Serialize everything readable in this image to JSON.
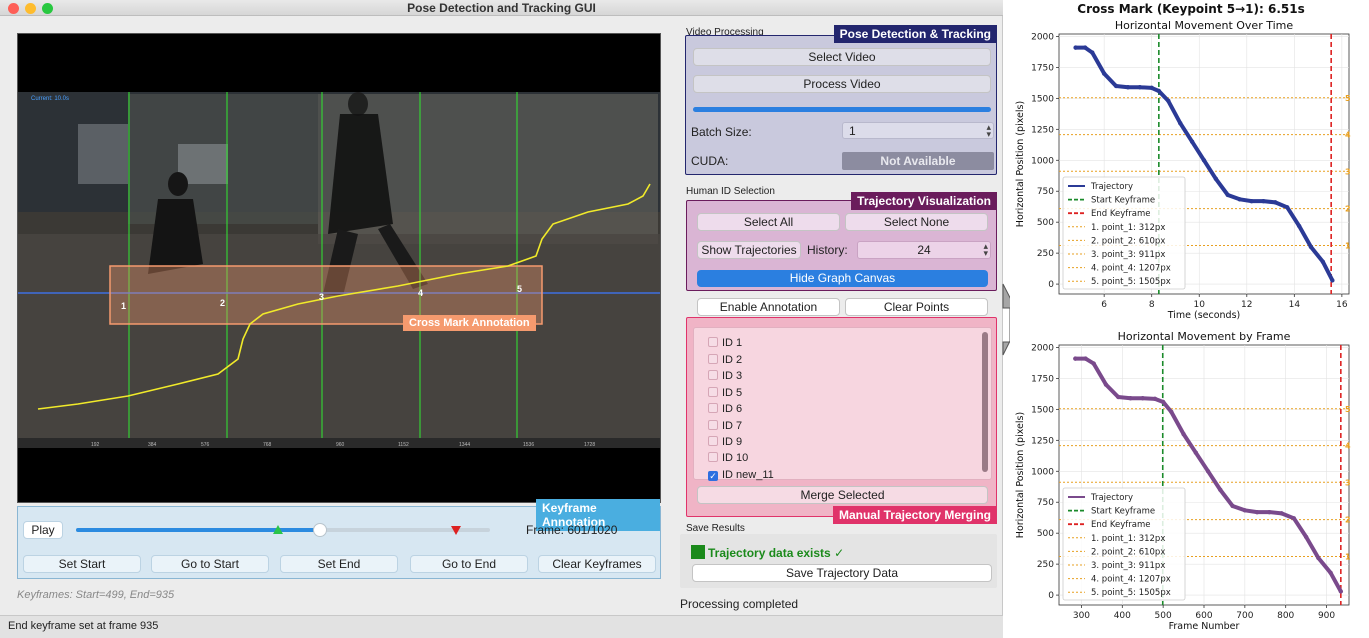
{
  "window": {
    "title": "Pose Detection and Tracking GUI",
    "traffic_lights": [
      "#fe5f57",
      "#febc2e",
      "#28c840"
    ]
  },
  "video": {
    "current_label": "Current: 10.0s",
    "cross_mark_label": "Cross Mark Annotation",
    "point_labels": [
      "1",
      "2",
      "3",
      "4",
      "5"
    ],
    "axis_ticks": [
      "192",
      "384",
      "576",
      "768",
      "960",
      "1152",
      "1344",
      "1536",
      "1728"
    ]
  },
  "keyframe": {
    "panel_label": "Keyframe Annotation",
    "play_label": "Play",
    "frame_text": "Frame: 601/1020",
    "slider_position": 0.589,
    "start_marker": 0.489,
    "end_marker": 0.917,
    "buttons": [
      "Set Start",
      "Go to Start",
      "Set End",
      "Go to End",
      "Clear Keyframes"
    ],
    "status_text": "Keyframes: Start=499, End=935"
  },
  "status_bar": "End keyframe set at frame 935",
  "video_processing": {
    "section_label": "Video Processing",
    "panel_label": "Pose Detection & Tracking",
    "select_video": "Select Video",
    "process_video": "Process Video",
    "progress": 1.0,
    "batch_size_label": "Batch Size:",
    "batch_size_value": "1",
    "cuda_label": "CUDA:",
    "cuda_value": "Not Available"
  },
  "human_id": {
    "section_label": "Human ID Selection",
    "panel_label": "Trajectory Visualization",
    "select_all": "Select All",
    "select_none": "Select None",
    "show_trajectories": "Show Trajectories",
    "history_label": "History:",
    "history_value": "24",
    "hide_graph": "Hide Graph Canvas",
    "enable_annotation": "Enable Annotation",
    "clear_points": "Clear Points",
    "ids": [
      {
        "label": "ID 1",
        "checked": false
      },
      {
        "label": "ID 2",
        "checked": false
      },
      {
        "label": "ID 3",
        "checked": false
      },
      {
        "label": "ID 5",
        "checked": false
      },
      {
        "label": "ID 6",
        "checked": false
      },
      {
        "label": "ID 7",
        "checked": false
      },
      {
        "label": "ID 9",
        "checked": false
      },
      {
        "label": "ID 10",
        "checked": false
      },
      {
        "label": "ID new_11",
        "checked": true
      }
    ],
    "merge_selected": "Merge Selected",
    "merge_panel_label": "Manual Trajectory Merging"
  },
  "save": {
    "section_label": "Save Results",
    "exists_text": "Trajectory data exists ✓",
    "save_button": "Save Trajectory Data",
    "status": "Processing completed"
  },
  "colors": {
    "pose_panel": "#23266e",
    "traj_panel": "#6a1c5c",
    "merge_panel": "#e0336a",
    "keyframe_panel": "#4aaee0",
    "cross_mark": "#f59a6e",
    "trajectory_time": "#2b3a96",
    "trajectory_frame": "#7a4a8c",
    "start_line": "#1a8a2a",
    "end_line": "#dd2222",
    "guide_line": "#e8a020"
  },
  "chart_data": [
    {
      "type": "line",
      "title": "Horizontal Movement Over Time",
      "suptitle": "Cross Mark (Keypoint 5→1): 6.51s",
      "xlabel": "Time (seconds)",
      "ylabel": "Horizontal Position (pixels)",
      "xlim": [
        4.1,
        16.3
      ],
      "ylim": [
        -80,
        2020
      ],
      "xticks": [
        "6",
        "8",
        "10",
        "12",
        "14",
        "16"
      ],
      "yticks": [
        "0",
        "250",
        "500",
        "750",
        "1000",
        "1250",
        "1500",
        "1750",
        "2000"
      ],
      "series": [
        {
          "name": "Trajectory",
          "x": [
            4.8,
            5.2,
            5.5,
            6.0,
            6.5,
            7.0,
            7.5,
            8.0,
            8.3,
            8.7,
            9.2,
            9.7,
            10.2,
            10.7,
            11.2,
            11.7,
            12.2,
            12.7,
            13.2,
            13.7,
            14.2,
            14.7,
            15.2,
            15.6
          ],
          "y": [
            1910,
            1910,
            1870,
            1700,
            1600,
            1590,
            1590,
            1585,
            1560,
            1480,
            1300,
            1150,
            1000,
            850,
            720,
            685,
            670,
            670,
            660,
            620,
            470,
            300,
            180,
            30
          ]
        }
      ],
      "vlines": [
        {
          "name": "Start Keyframe",
          "x": 8.3
        },
        {
          "name": "End Keyframe",
          "x": 15.55
        }
      ],
      "hlines": [
        {
          "name": "1. point_1: 312px",
          "y": 312,
          "tag": "1"
        },
        {
          "name": "2. point_2: 610px",
          "y": 610,
          "tag": "2"
        },
        {
          "name": "3. point_3: 911px",
          "y": 911,
          "tag": "3"
        },
        {
          "name": "4. point_4: 1207px",
          "y": 1207,
          "tag": "4"
        },
        {
          "name": "5. point_5: 1505px",
          "y": 1505,
          "tag": "5"
        }
      ],
      "legend_position": "lower-left",
      "grid": true
    },
    {
      "type": "line",
      "title": "Horizontal Movement by Frame",
      "xlabel": "Frame Number",
      "ylabel": "Horizontal Position (pixels)",
      "xlim": [
        245,
        955
      ],
      "ylim": [
        -80,
        2020
      ],
      "xticks": [
        "300",
        "400",
        "500",
        "600",
        "700",
        "800",
        "900"
      ],
      "yticks": [
        "0",
        "250",
        "500",
        "750",
        "1000",
        "1250",
        "1500",
        "1750",
        "2000"
      ],
      "series": [
        {
          "name": "Trajectory",
          "x": [
            285,
            310,
            330,
            360,
            390,
            420,
            450,
            480,
            500,
            520,
            550,
            580,
            610,
            640,
            670,
            700,
            730,
            760,
            790,
            820,
            850,
            880,
            910,
            935
          ],
          "y": [
            1910,
            1910,
            1870,
            1700,
            1600,
            1590,
            1590,
            1585,
            1560,
            1480,
            1300,
            1150,
            1000,
            850,
            720,
            685,
            670,
            670,
            660,
            620,
            470,
            300,
            180,
            30
          ]
        }
      ],
      "vlines": [
        {
          "name": "Start Keyframe",
          "x": 499
        },
        {
          "name": "End Keyframe",
          "x": 935
        }
      ],
      "hlines": [
        {
          "name": "1. point_1: 312px",
          "y": 312,
          "tag": "1"
        },
        {
          "name": "2. point_2: 610px",
          "y": 610,
          "tag": "2"
        },
        {
          "name": "3. point_3: 911px",
          "y": 911,
          "tag": "3"
        },
        {
          "name": "4. point_4: 1207px",
          "y": 1207,
          "tag": "4"
        },
        {
          "name": "5. point_5: 1505px",
          "y": 1505,
          "tag": "5"
        }
      ],
      "legend_position": "lower-left",
      "grid": true
    }
  ]
}
